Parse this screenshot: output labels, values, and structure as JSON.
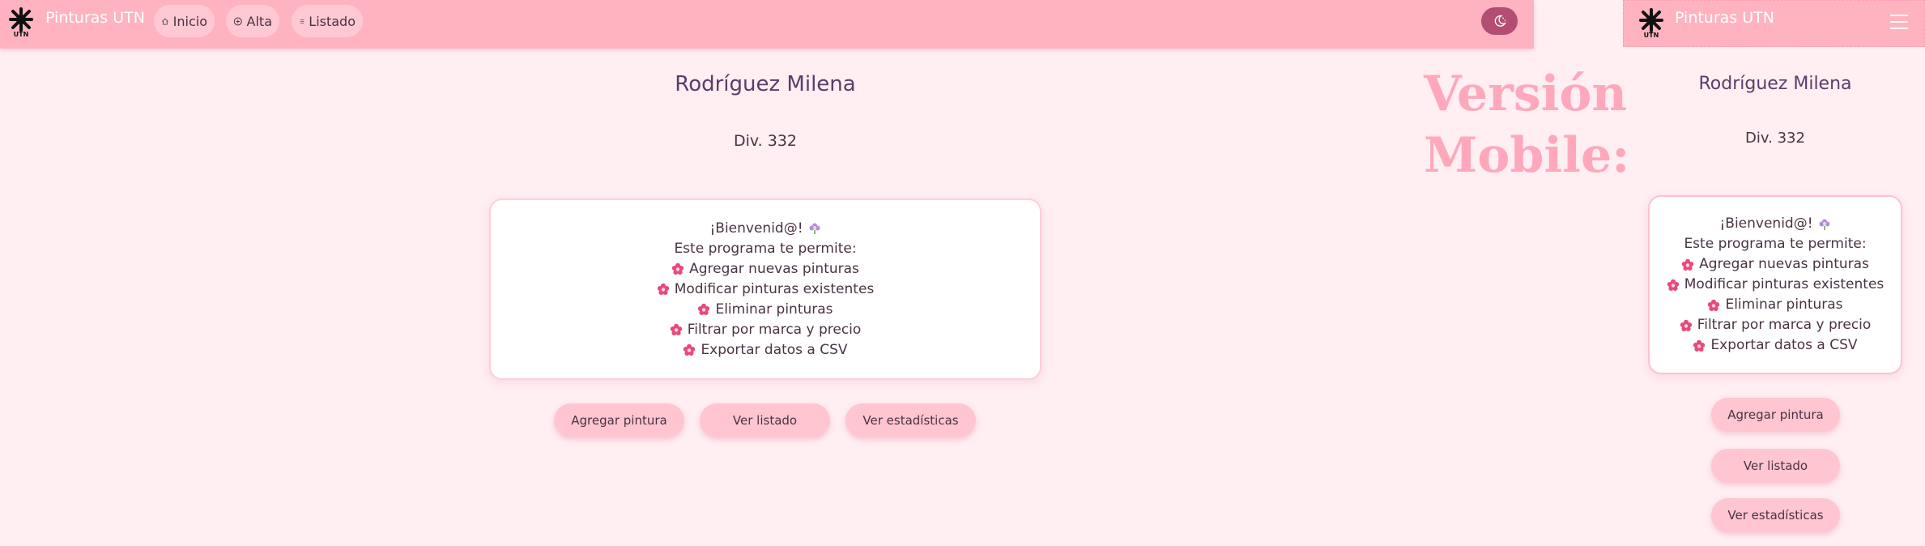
{
  "desktop": {
    "nav": {
      "brand": "Pinturas UTN",
      "items": [
        {
          "label": "Inicio",
          "icon": "home-icon"
        },
        {
          "label": "Alta",
          "icon": "plus-circle-icon"
        },
        {
          "label": "Listado",
          "icon": "list-icon"
        }
      ],
      "theme_toggle_icon": "moon-stars-icon"
    },
    "title": "Rodríguez Milena",
    "subtitle": "Div. 332",
    "welcome": {
      "line1": "¡Bienvenid@!",
      "line2": "Este programa te permite:",
      "features": [
        "Agregar nuevas pinturas",
        "Modificar pinturas existentes",
        "Eliminar pinturas",
        "Filtrar por marca y precio",
        "Exportar datos a CSV"
      ]
    },
    "buttons": {
      "add": "Agregar pintura",
      "list": "Ver listado",
      "stats": "Ver estadísticas"
    }
  },
  "mobile_label": {
    "line1": "Versión",
    "line2": "Mobile:"
  },
  "mobile": {
    "nav": {
      "brand": "Pinturas UTN",
      "menu_icon": "hamburger-icon"
    },
    "title": "Rodríguez Milena",
    "subtitle": "Div. 332",
    "welcome": {
      "line1": "¡Bienvenid@!",
      "line2": "Este programa te permite:",
      "features": [
        "Agregar nuevas pinturas",
        "Modificar pinturas existentes",
        "Eliminar pinturas",
        "Filtrar por marca y precio",
        "Exportar datos a CSV"
      ]
    },
    "buttons": {
      "add": "Agregar pintura",
      "list": "Ver listado",
      "stats": "Ver estadísticas"
    }
  },
  "colors": {
    "background": "#ffeef2",
    "navbar": "#ffb3c0",
    "button": "#ffc5d0",
    "theme_toggle": "#b34d72",
    "flower": "#e8497a",
    "mobile_label": "#ffa8bc"
  }
}
